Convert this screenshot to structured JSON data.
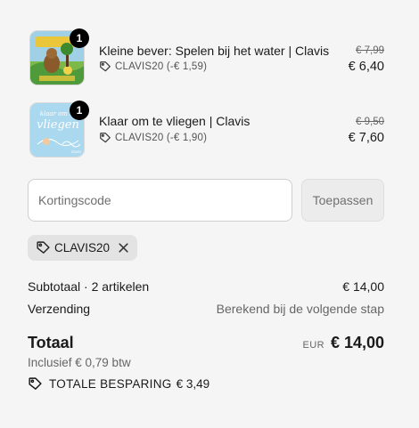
{
  "items": [
    {
      "qty": "1",
      "title": "Kleine bever: Spelen bij het water | Clavis",
      "discount": "CLAVIS20 (-€ 1,59)",
      "compare_price": "€ 7,99",
      "price": "€ 6,40",
      "icon": "tag-icon"
    },
    {
      "qty": "1",
      "title": "Klaar om te vliegen | Clavis",
      "discount": "CLAVIS20 (-€ 1,90)",
      "compare_price": "€ 9,50",
      "price": "€ 7,60",
      "icon": "tag-icon"
    }
  ],
  "discount_form": {
    "placeholder": "Kortingscode",
    "value": "",
    "apply_label": "Toepassen"
  },
  "applied_code": {
    "label": "CLAVIS20"
  },
  "summary": {
    "subtotal_label": "Subtotaal · 2 artikelen",
    "subtotal_value": "€ 14,00",
    "shipping_label": "Verzending",
    "shipping_value": "Berekend bij de volgende stap",
    "total_label": "Totaal",
    "currency": "EUR",
    "total_value": "€ 14,00",
    "tax_note": "Inclusief € 0,79 btw",
    "savings_label": "TOTALE BESPARING",
    "savings_value": "€ 3,49"
  },
  "colors": {
    "background": "#f5f5f5",
    "badge": "#000000",
    "muted": "#666666"
  }
}
